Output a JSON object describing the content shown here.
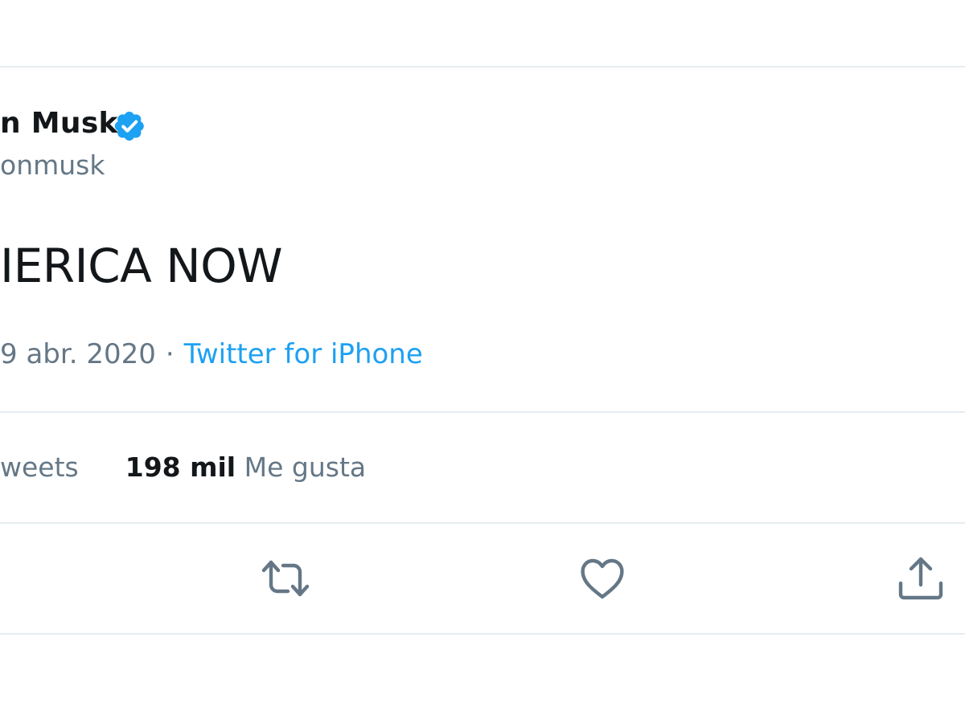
{
  "tweet": {
    "author_name": "n Musk",
    "handle": "onmusk",
    "text": "IERICA NOW",
    "date": "9 abr. 2020",
    "separator": "·",
    "source": "Twitter for iPhone",
    "retweets_label": "weets",
    "likes_count": "198 mil",
    "likes_label": "Me gusta"
  },
  "icons": {
    "verified": "verified-badge-icon",
    "retweet": "retweet-icon",
    "like": "heart-icon",
    "share": "share-icon"
  },
  "colors": {
    "link": "#1da1f2",
    "muted": "#657786",
    "text": "#14171a",
    "border": "#e6ecf0"
  }
}
